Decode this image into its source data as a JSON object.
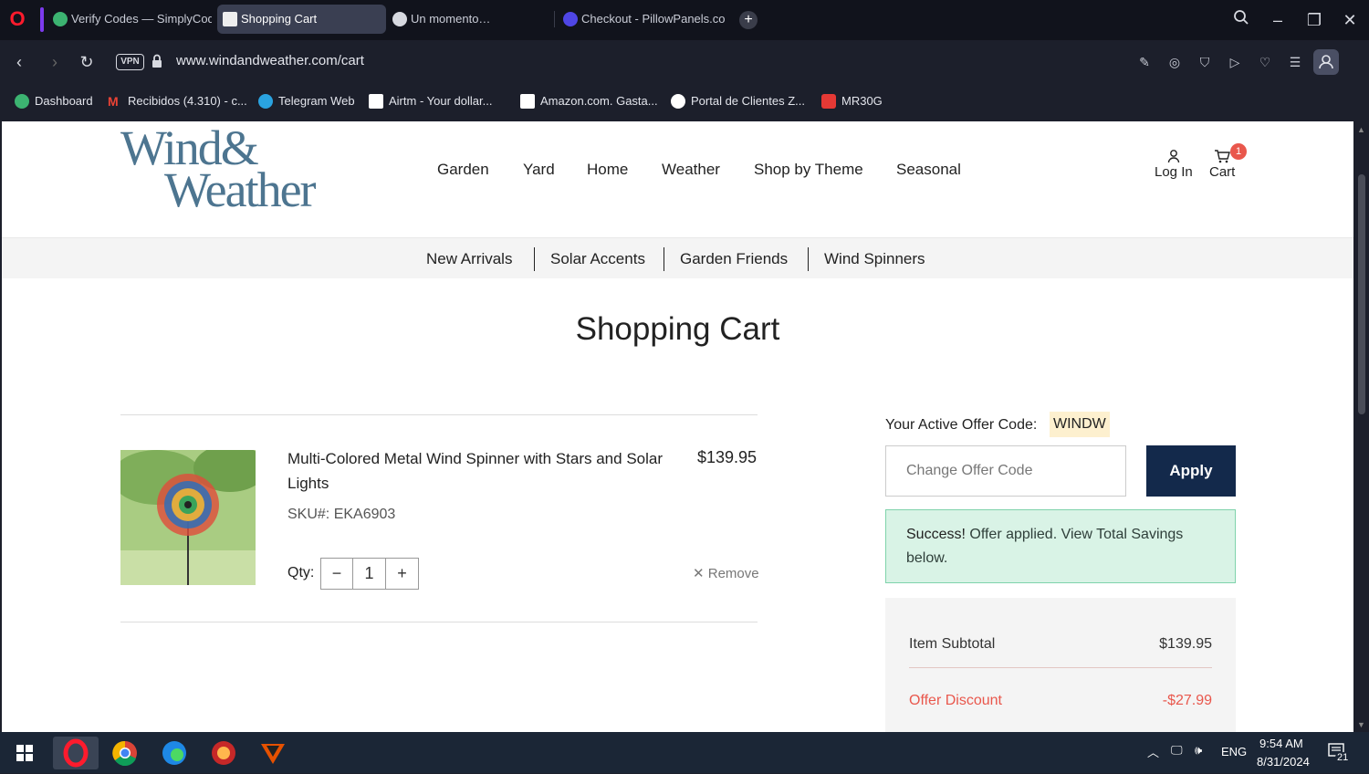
{
  "browser": {
    "tabs": [
      {
        "label": "Verify Codes — SimplyCodes",
        "active": false
      },
      {
        "label": "Shopping Cart",
        "active": true
      },
      {
        "label": "Un momento…",
        "active": false
      },
      {
        "label": "Checkout - PillowPanels.com",
        "active": false
      }
    ],
    "vpn_label": "VPN",
    "url": "www.windandweather.com/cart",
    "bookmarks": [
      "Dashboard",
      "Recibidos (4.310) - c...",
      "Telegram Web",
      "Airtm - Your dollar...",
      "Amazon.com. Gasta...",
      "Portal de Clientes Z...",
      "MR30G"
    ]
  },
  "site": {
    "logo_line1": "Wind&",
    "logo_line2": "Weather",
    "main_nav": [
      "Garden",
      "Yard",
      "Home",
      "Weather",
      "Shop by Theme",
      "Seasonal"
    ],
    "login_label": "Log In",
    "cart_label": "Cart",
    "cart_count": "1",
    "sub_nav": [
      "New Arrivals",
      "Solar Accents",
      "Garden Friends",
      "Wind Spinners"
    ]
  },
  "cart": {
    "title": "Shopping Cart",
    "item": {
      "name": "Multi-Colored Metal Wind Spinner with Stars and Solar Lights",
      "price": "$139.95",
      "sku": "SKU#: EKA6903",
      "qty_label": "Qty:",
      "qty_minus": "−",
      "qty_value": "1",
      "qty_plus": "+",
      "remove_label": "Remove"
    }
  },
  "offer": {
    "label": "Your Active Offer Code:",
    "code": "WINDW",
    "input_placeholder": "Change Offer Code",
    "apply_label": "Apply",
    "success_strong": "Success!",
    "success_text": " Offer applied. View Total Savings below."
  },
  "summary": {
    "subtotal_label": "Item Subtotal",
    "subtotal_value": "$139.95",
    "discount_label": "Offer Discount",
    "discount_value": "-$27.99",
    "discount_color": "#e9574c"
  },
  "taskbar": {
    "language": "ENG",
    "time": "9:54 AM",
    "date": "8/31/2024",
    "notifications": "21"
  }
}
